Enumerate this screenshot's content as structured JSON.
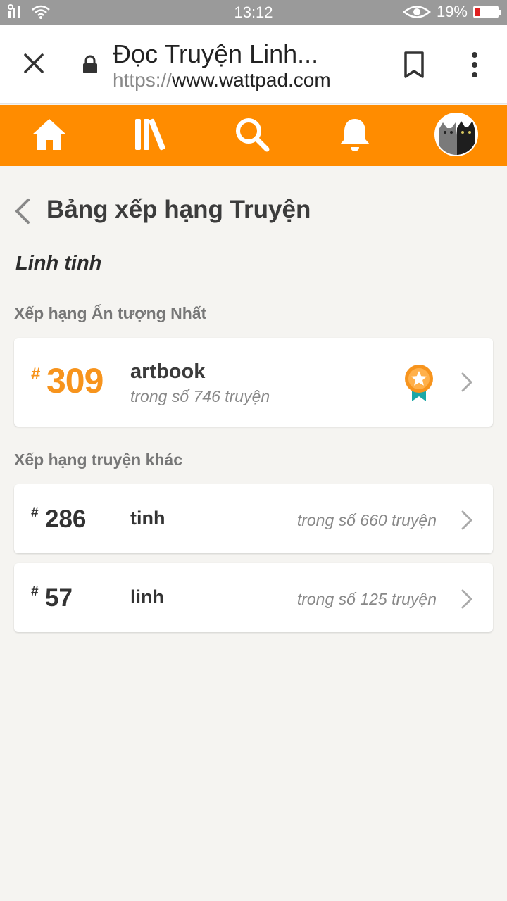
{
  "status_bar": {
    "time": "13:12",
    "battery_percent": "19%",
    "battery_level": 0.19,
    "icons": [
      "signal-icon",
      "wifi-icon",
      "eye-comfort-icon",
      "battery-icon"
    ]
  },
  "browser": {
    "page_title": "Đọc Truyện Linh...",
    "url_scheme": "https://",
    "url_host": "www.wattpad.com",
    "icons": [
      "close-icon",
      "lock-icon",
      "bookmark-icon",
      "more-vert-icon"
    ]
  },
  "nav": {
    "accent_color": "#ff8c00",
    "items": [
      "home-icon",
      "library-icon",
      "search-icon",
      "notifications-icon",
      "profile-avatar"
    ]
  },
  "page": {
    "title": "Bảng xếp hạng Truyện",
    "category": "Linh tinh"
  },
  "featured_section": {
    "label": "Xếp hạng Ấn tượng Nhất",
    "hash": "#",
    "rank": "309",
    "tag": "artbook",
    "subtitle": "trong số 746 truyện",
    "accent_color": "#f7941d"
  },
  "other_section": {
    "label": "Xếp hạng truyện khác",
    "rows": [
      {
        "hash": "#",
        "rank": "286",
        "tag": "tinh",
        "subtitle": "trong số 660 truyện"
      },
      {
        "hash": "#",
        "rank": "57",
        "tag": "linh",
        "subtitle": "trong số 125 truyện"
      }
    ]
  }
}
